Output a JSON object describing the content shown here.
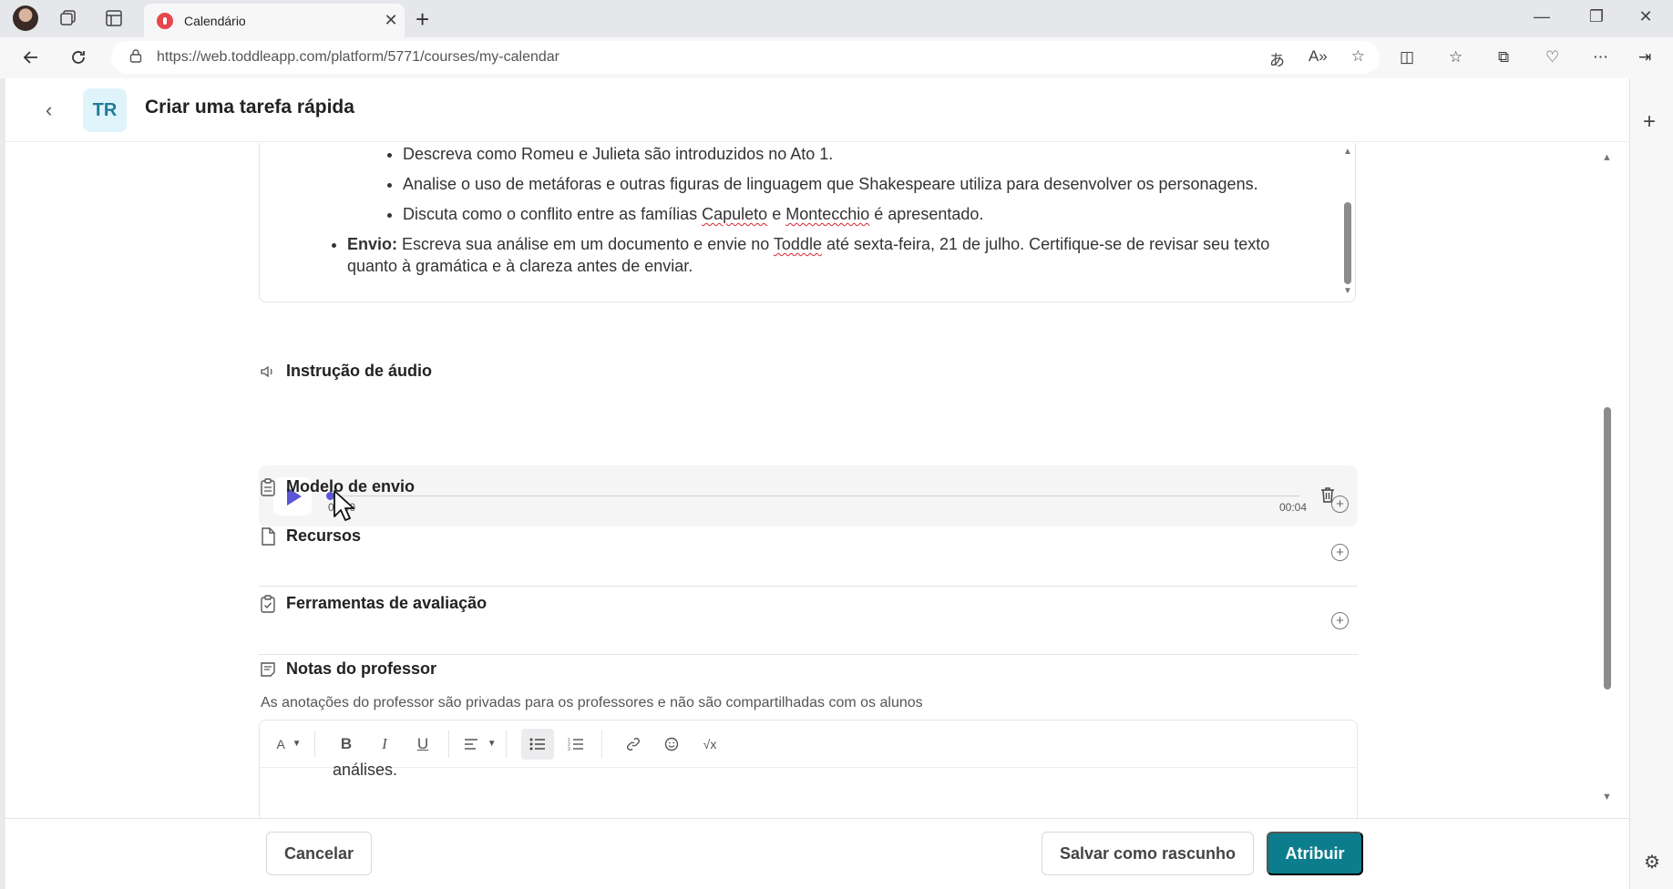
{
  "browser": {
    "tab_title": "Calendário",
    "tab_close": "✕",
    "new_tab": "+",
    "url": "https://web.toddleapp.com/platform/5771/courses/my-calendar",
    "window_controls": [
      "—",
      "❐",
      "✕"
    ]
  },
  "header": {
    "badge": "TR",
    "title": "Criar uma tarefa rápida"
  },
  "description": {
    "sub_items": [
      "Descreva como Romeu e Julieta são introduzidos no Ato 1.",
      "Analise o uso de metáforas e outras figuras de linguagem que Shakespeare utiliza para desenvolver os personagens.",
      "Discuta como o conflito entre as famílias Capuleto e Montecchio é apresentado."
    ],
    "sub3_parts": [
      "Discuta como o conflito entre as famílias ",
      "Capuleto",
      " e ",
      "Montecchio",
      " é apresentado."
    ],
    "envio_label": "Envio:",
    "envio_parts": [
      " Escreva sua análise em um documento e envie no ",
      "Toddle",
      " até sexta-feira, 21 de julho. Certifique-se de revisar seu texto quanto à gramática e à clareza antes de enviar."
    ]
  },
  "audio": {
    "title": "Instrução de áudio",
    "time_current": "00:00",
    "time_total": "00:04",
    "progress": 0
  },
  "sections": {
    "submission_model": "Modelo de envio",
    "resources": "Recursos",
    "assessment_tools": "Ferramentas de avaliação",
    "teacher_notes": "Notas do professor",
    "teacher_notes_sub": "As anotações do professor são privadas para os professores e não são compartilhadas com os alunos"
  },
  "editor": {
    "toolbar": [
      "A",
      "B",
      "I",
      "U",
      "align",
      "bullets",
      "numbered",
      "link",
      "emoji",
      "formula"
    ],
    "font_label": "A",
    "bold": "B",
    "italic": "I",
    "underline": "U",
    "formula": "√x",
    "visible_text": "análises."
  },
  "footer": {
    "cancel": "Cancelar",
    "save_draft": "Salvar como rascunho",
    "assign": "Atribuir"
  },
  "colors": {
    "accent": "#0c7d8c",
    "play": "#5b56d6",
    "badge_bg": "#dff3fb"
  }
}
